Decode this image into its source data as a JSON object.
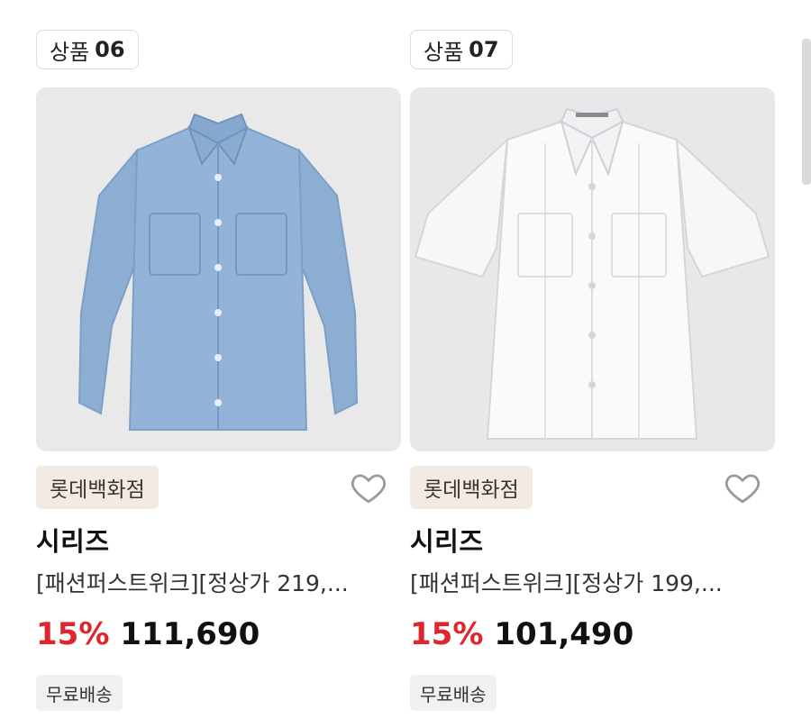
{
  "products": [
    {
      "tag_label": "상품",
      "tag_number": "06",
      "brand": "롯데백화점",
      "title": "시리즈",
      "description": "[패션퍼스트위크][정상가 219,...",
      "discount": "15%",
      "price": "111,690",
      "shipping": "무료배송",
      "image_icon": "blue-linen-long-sleeve-shirt",
      "heart_icon": "heart-outline-icon"
    },
    {
      "tag_label": "상품",
      "tag_number": "07",
      "brand": "롯데백화점",
      "title": "시리즈",
      "description": "[패션퍼스트위크][정상가 199,...",
      "discount": "15%",
      "price": "101,490",
      "shipping": "무료배송",
      "image_icon": "white-short-sleeve-guayabera-shirt",
      "heart_icon": "heart-outline-icon"
    }
  ],
  "colors": {
    "discount": "#e0262d",
    "brand_badge_bg": "#f2ebe4",
    "shipping_badge_bg": "#f1f1f1",
    "photo_bg": "#e9e9ea"
  }
}
